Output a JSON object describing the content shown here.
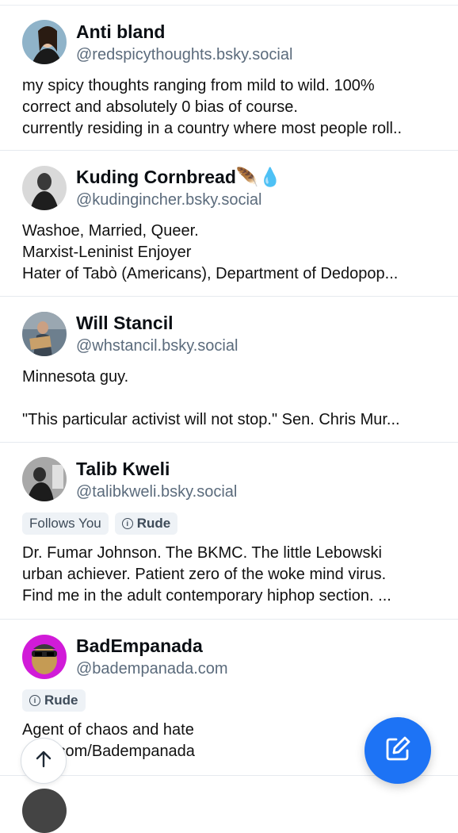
{
  "profiles": [
    {
      "name": "Anti bland",
      "handle": "@redspicythoughts.bsky.social",
      "description": "my spicy thoughts ranging from mild to wild. 100%\ncorrect and absolutely 0 bias of course.\ncurrently residing in a country where most people roll..",
      "badges": []
    },
    {
      "name": "Kuding Cornbread🪶💧",
      "handle": "@kudingincher.bsky.social",
      "description": "Washoe, Married, Queer.\nMarxist-Leninist Enjoyer\nHater of Tabò (Americans),  Department of Dedopop...",
      "badges": []
    },
    {
      "name": "Will Stancil",
      "handle": "@whstancil.bsky.social",
      "description": "Minnesota guy.\n\n\"This particular activist will not stop.\" Sen. Chris Mur...",
      "badges": []
    },
    {
      "name": "Talib Kweli",
      "handle": "@talibkweli.bsky.social",
      "description": "Dr. Fumar Johnson. The BKMC. The little Lebowski\nurban achiever. Patient zero of the woke mind virus.\nFind me in the adult contemporary hiphop section. ...",
      "badges": [
        "Follows You",
        "Rude"
      ]
    },
    {
      "name": "BadEmpanada",
      "handle": "@badempanada.com",
      "description": "Agent of chaos and hate\n​ ube.com/Badempanada",
      "badges": [
        "Rude"
      ]
    }
  ],
  "fab": {
    "icon": "compose-icon",
    "color": "#1d73f5"
  },
  "scroll_top": {
    "icon": "arrow-up-icon"
  }
}
